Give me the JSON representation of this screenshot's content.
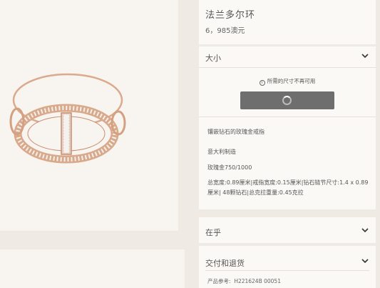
{
  "product": {
    "title": "法兰多尔环",
    "price": "6，985澳元"
  },
  "size": {
    "label": "大小",
    "notice": "所需的尺寸不再可用"
  },
  "description": {
    "name": "镶嵌钻石的玫瑰金戒指",
    "origin": "意大利制造",
    "material": "玫瑰金750/1000",
    "dimensions": "总宽度:0.89厘米|戒指宽度:0.15厘米|钻石链节尺寸:1.4 x 0.89厘米| 48颗钻石|总克拉重量:0.45克拉"
  },
  "care": {
    "label": "在乎"
  },
  "delivery": {
    "label": "交付和退货"
  },
  "reference": {
    "label": "产品参考:",
    "value": "H221624B 00051"
  },
  "colors": {
    "rose_gold": "#d9a98c",
    "button": "#6e6e6e"
  },
  "icons": [
    "chevron-down-icon",
    "info-icon",
    "loading-spinner-icon"
  ]
}
